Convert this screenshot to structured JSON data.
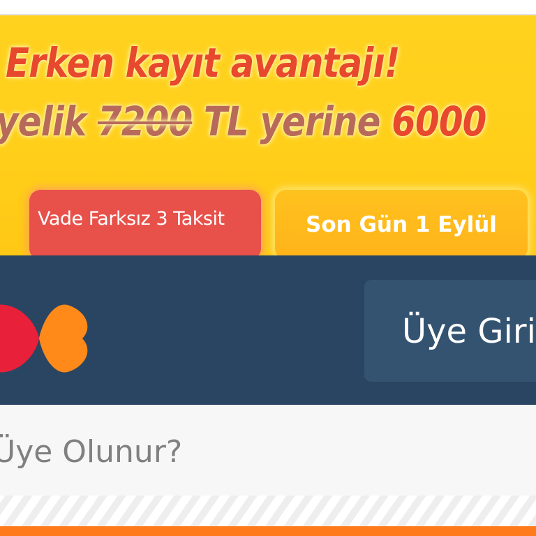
{
  "promo": {
    "headline": "Erken kayıt avantajı!",
    "price_prefix": "yelik ",
    "old_price": "7200",
    "price_middle": " TL yerine ",
    "new_price": "6000",
    "badge_installments": "Vade Farksız 3 Taksit",
    "badge_deadline": "Son Gün 1 Eylül"
  },
  "header": {
    "logo_icon": "heart-shapes-logo",
    "login_label": "Üye Giri"
  },
  "section": {
    "question": "Üye Olunur?"
  },
  "colors": {
    "banner_yellow": "#ffcf1a",
    "headline_red": "#e8482c",
    "header_navy": "#2a4561",
    "login_button": "#335371",
    "accent_orange": "#ff7a1a"
  }
}
